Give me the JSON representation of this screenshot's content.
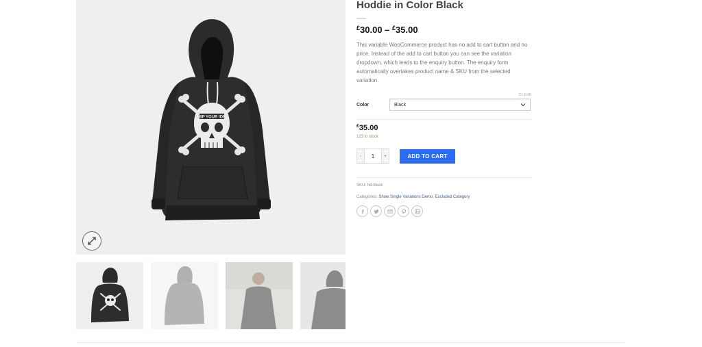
{
  "product": {
    "title": "Hoddie in Color Black",
    "price_range": {
      "currency": "£",
      "low": "30.00",
      "dash": " – ",
      "high": "35.00"
    },
    "description": "This variable WooCommerce product has no add to cart button and no price. Instead of the add to cart button you can see the variation dropdown, which leads to the enquiry button. The enquiry form automatically overtakes product name & SKU from the selected variation.",
    "clear_label": "CLEAR",
    "variation": {
      "label": "Color",
      "selected": "Black"
    },
    "variation_price": {
      "currency": "£",
      "amount": "35.00"
    },
    "stock": "123 in stock",
    "quantity": {
      "minus": "-",
      "value": "1",
      "plus": "+"
    },
    "add_to_cart_label": "ADD TO CART",
    "sku_label": "SKU:",
    "sku_value": "hd-black",
    "categories_label": "Categories:",
    "categories": [
      "Show Single Variations Demo",
      "Excluded Category"
    ],
    "category_sep": ", ",
    "print_lettering": "SHIP YOUR IDEA"
  },
  "share_icons": [
    "facebook-icon",
    "twitter-icon",
    "email-icon",
    "pinterest-icon",
    "linkedin-icon"
  ],
  "colors": {
    "accent": "#2c6cf0",
    "link": "#446084",
    "stock": "#7a9c59",
    "hoodie": "#2b2b2b"
  }
}
